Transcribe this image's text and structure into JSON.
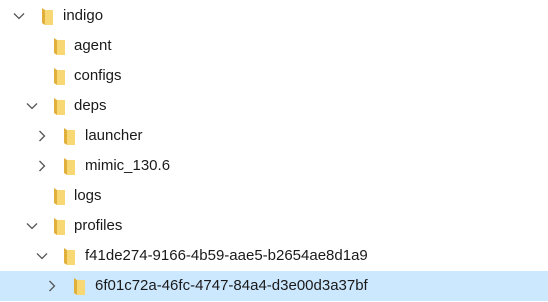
{
  "tree": {
    "nodes": [
      {
        "label": "indigo",
        "expander": "chevron-down-icon"
      },
      {
        "label": "agent",
        "expander": "none"
      },
      {
        "label": "configs",
        "expander": "none"
      },
      {
        "label": "deps",
        "expander": "chevron-down-icon"
      },
      {
        "label": "launcher",
        "expander": "chevron-right-icon"
      },
      {
        "label": "mimic_130.6",
        "expander": "chevron-right-icon"
      },
      {
        "label": "logs",
        "expander": "none"
      },
      {
        "label": "profiles",
        "expander": "chevron-down-icon"
      },
      {
        "label": "f41de274-9166-4b59-aae5-b2654ae8d1a9",
        "expander": "chevron-down-icon"
      },
      {
        "label": "6f01c72a-46fc-4747-84a4-d3e00d3a37bf",
        "expander": "chevron-right-icon",
        "selected": true
      }
    ]
  },
  "colors": {
    "folder_fill": "#f8d775",
    "folder_dark": "#e0b03a",
    "selection": "#cce8ff",
    "chevron": "#555555"
  }
}
